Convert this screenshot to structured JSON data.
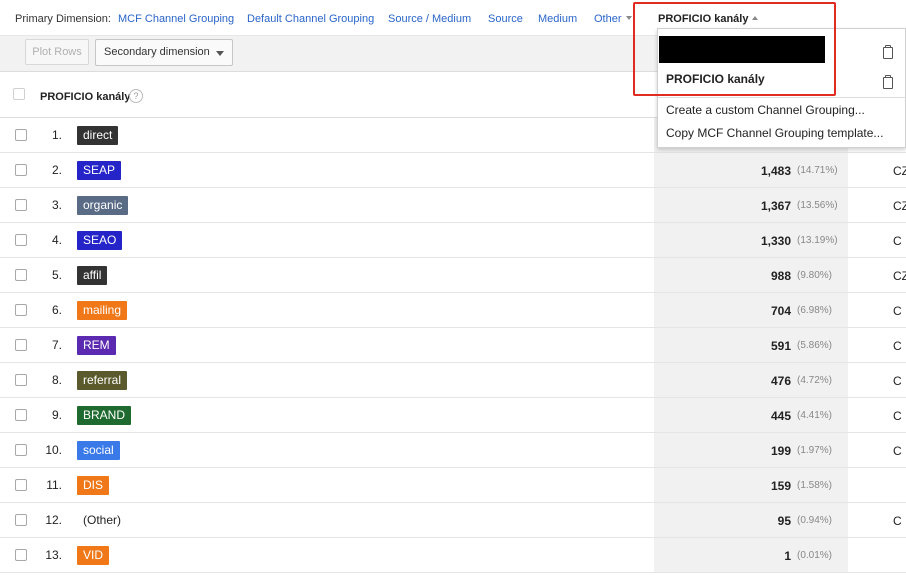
{
  "primary_dimension": {
    "label": "Primary Dimension:",
    "links": [
      "MCF Channel Grouping",
      "Default Channel Grouping",
      "Source / Medium",
      "Source",
      "Medium"
    ],
    "other_label": "Other",
    "selected": "PROFICIO kanály"
  },
  "toolbar": {
    "plot_rows_label": "Plot Rows",
    "secondary_dimension_label": "Secondary dimension"
  },
  "table": {
    "header_label": "PROFICIO kanály",
    "rows": [
      {
        "num": "1.",
        "channel": "direct",
        "color": "#333333",
        "value": "",
        "pct": "",
        "extra": ""
      },
      {
        "num": "2.",
        "channel": "SEAP",
        "color": "#2424c8",
        "value": "1,483",
        "pct": "(14.71%)",
        "extra": "CZ"
      },
      {
        "num": "3.",
        "channel": "organic",
        "color": "#5a6b86",
        "value": "1,367",
        "pct": "(13.56%)",
        "extra": "CZ"
      },
      {
        "num": "4.",
        "channel": "SEAO",
        "color": "#2424c8",
        "value": "1,330",
        "pct": "(13.19%)",
        "extra": "C"
      },
      {
        "num": "5.",
        "channel": "affil",
        "color": "#333333",
        "value": "988",
        "pct": "(9.80%)",
        "extra": "CZ"
      },
      {
        "num": "6.",
        "channel": "mailing",
        "color": "#f07818",
        "value": "704",
        "pct": "(6.98%)",
        "extra": "C"
      },
      {
        "num": "7.",
        "channel": "REM",
        "color": "#5c2ab0",
        "value": "591",
        "pct": "(5.86%)",
        "extra": "C"
      },
      {
        "num": "8.",
        "channel": "referral",
        "color": "#5a5a2c",
        "value": "476",
        "pct": "(4.72%)",
        "extra": "C"
      },
      {
        "num": "9.",
        "channel": "BRAND",
        "color": "#1f6a2e",
        "value": "445",
        "pct": "(4.41%)",
        "extra": "C"
      },
      {
        "num": "10.",
        "channel": "social",
        "color": "#3a7ae8",
        "value": "199",
        "pct": "(1.97%)",
        "extra": "C"
      },
      {
        "num": "11.",
        "channel": "DIS",
        "color": "#f07818",
        "value": "159",
        "pct": "(1.58%)",
        "extra": ""
      },
      {
        "num": "12.",
        "channel": "(Other)",
        "color": "",
        "value": "95",
        "pct": "(0.94%)",
        "extra": "C"
      },
      {
        "num": "13.",
        "channel": "VID",
        "color": "#f07818",
        "value": "1",
        "pct": "(0.01%)",
        "extra": ""
      }
    ]
  },
  "dropdown": {
    "selected_item": "PROFICIO kanály",
    "actions": [
      "Create a custom Channel Grouping...",
      "Copy MCF Channel Grouping template..."
    ]
  },
  "colors": {
    "link": "#2a65c9",
    "highlight": "#e02b20"
  }
}
